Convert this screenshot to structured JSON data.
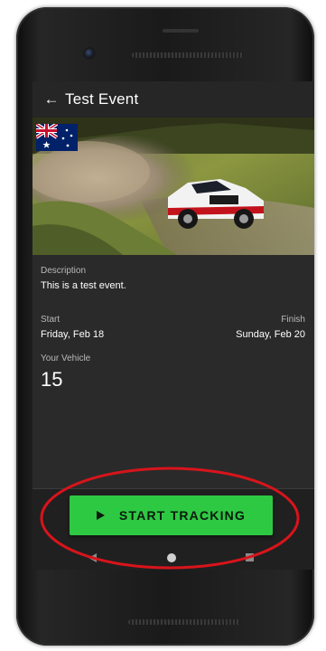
{
  "app": {
    "title": "Test Event"
  },
  "event": {
    "description_label": "Description",
    "description": "This is a test event.",
    "start_label": "Start",
    "start_date": "Friday, Feb 18",
    "finish_label": "Finish",
    "finish_date": "Sunday, Feb 20",
    "vehicle_label": "Your Vehicle",
    "vehicle_number": "15",
    "flag_icon": "australia-flag-icon"
  },
  "actions": {
    "start_tracking_label": "START TRACKING"
  },
  "colors": {
    "accent_green": "#2ec943",
    "background": "#2a2a2a",
    "annotation_red": "#d8141b"
  },
  "icons": {
    "back": "arrow-left-icon",
    "play": "play-icon",
    "nav_back": "nav-back-icon",
    "nav_home": "nav-home-icon",
    "nav_recents": "nav-recents-icon"
  }
}
